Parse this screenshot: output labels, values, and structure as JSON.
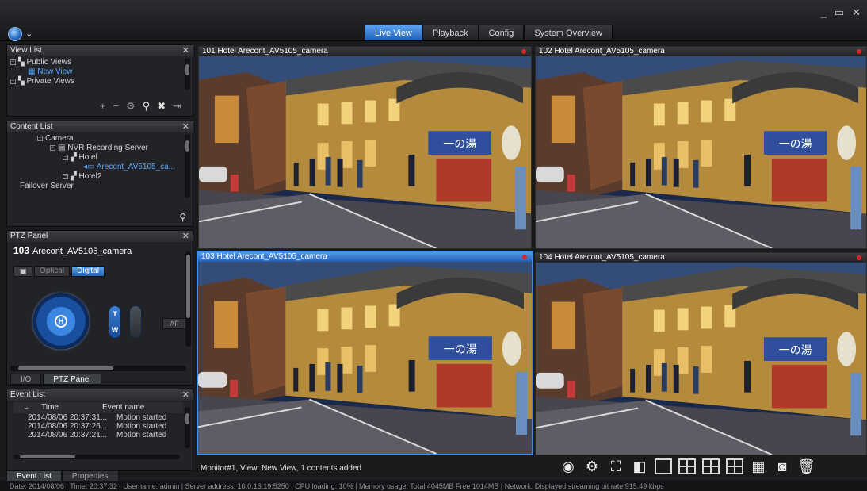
{
  "app": {
    "tabs": [
      {
        "label": "Live View",
        "active": true
      },
      {
        "label": "Playback"
      },
      {
        "label": "Config"
      },
      {
        "label": "System Overview"
      }
    ],
    "window_controls": [
      "_",
      "▭",
      "✕"
    ]
  },
  "view_list": {
    "title": "View List",
    "items": [
      {
        "label": "Public Views",
        "level": 0
      },
      {
        "label": "New View",
        "level": 1,
        "selected": true
      },
      {
        "label": "Private Views",
        "level": 0
      }
    ],
    "tools": [
      "+",
      "−",
      "⚙",
      "⚲",
      "✖",
      "⇥"
    ]
  },
  "content_list": {
    "title": "Content List",
    "items": [
      {
        "label": "Camera",
        "level": 2
      },
      {
        "label": "NVR Recording Server",
        "level": 3
      },
      {
        "label": "Hotel",
        "level": 4
      },
      {
        "label": "Arecont_AV5105_ca...",
        "level": 5,
        "selected": true
      },
      {
        "label": "Hotel2",
        "level": 4
      },
      {
        "label": "Failover Server",
        "level": 1
      }
    ]
  },
  "ptz": {
    "title": "PTZ Panel",
    "camera_number": "103",
    "camera_name": "Arecont_AV5105_camera",
    "modes": [
      "Optical",
      "Digital"
    ],
    "active_mode": "Digital",
    "joystick_label": "H",
    "zoom_top": "T",
    "zoom_bottom": "W",
    "af_label": "AF",
    "tabs": [
      "I/O",
      "PTZ Panel"
    ]
  },
  "event_list": {
    "title": "Event List",
    "columns": [
      "Time",
      "Event name"
    ],
    "rows": [
      [
        "2014/08/06  20:37:31...",
        "Motion started"
      ],
      [
        "2014/08/06  20:37:26...",
        "Motion started"
      ],
      [
        "2014/08/06  20:37:21...",
        "Motion started"
      ]
    ],
    "tabs": [
      "Event List",
      "Properties"
    ]
  },
  "cameras": [
    {
      "label": "101  Hotel  Arecont_AV5105_camera"
    },
    {
      "label": "102  Hotel  Arecont_AV5105_camera"
    },
    {
      "label": "103  Hotel  Arecont_AV5105_camera",
      "active": true
    },
    {
      "label": "104  Hotel  Arecont_AV5105_camera"
    }
  ],
  "sign_text": "一の湯",
  "status_message": "Monitor#1, View: New View, 1 contents added",
  "statusbar": "Date: 2014/08/06  |  Time: 20:37:32  |  Username: admin  |  Server address: 10.0.16.19:5250  |  CPU loading: 10%  |  Memory usage: Total 4045MB  Free 1014MB  |  Network: Displayed streaming bit rate   915.49 kbps",
  "colors": {
    "accent": "#2d6fc8",
    "background": "#1a1b1d",
    "recording_dot": "#e02424"
  }
}
